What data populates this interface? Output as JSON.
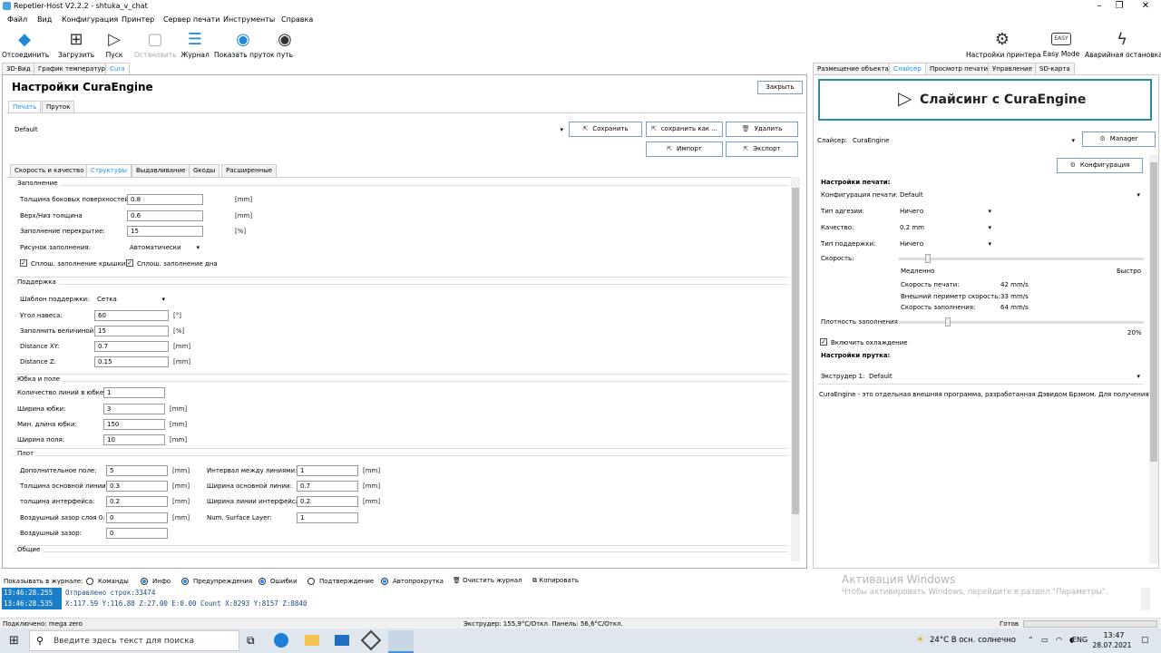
{
  "window": {
    "title": "Repetier-Host V2.2.2 - shtuka_v_chat"
  },
  "menu": [
    "Файл",
    "Вид",
    "Конфигурация",
    "Принтер",
    "Сервер печати",
    "Инструменты",
    "Справка"
  ],
  "toolbar": {
    "disconnect": "Отсоединить",
    "load": "Загрузить",
    "run": "Пуск",
    "stop": "Остановить",
    "journal": "Журнал",
    "show_filament": "Показать пруток",
    "path": "путь",
    "printer_settings": "Настройки принтера",
    "easy_mode": "Easy Mode",
    "easy_badge": "EASY",
    "emergency": "Аварийная остановка"
  },
  "left_tabs": [
    "3D-Вид",
    "График температур",
    "Cura"
  ],
  "right_tabs": [
    "Размещение объекта",
    "Слайсер",
    "Просмотр печати",
    "Управление",
    "SD-карта"
  ],
  "cura": {
    "title": "Настройки CuraEngine",
    "close": "Закрыть",
    "subtabs": [
      "Печать",
      "Пруток"
    ],
    "profile": "Default",
    "buttons": {
      "save": "Сохранить",
      "save_as": "сохранить как ...",
      "delete": "Удалить",
      "import": "Импорт",
      "export": "Экспорт"
    },
    "section_tabs": [
      "Скорость и качество",
      "Структуры",
      "Выдавливание",
      "Gкоды",
      "Расширенные"
    ],
    "infill": {
      "title": "Заполнение",
      "shell": {
        "label": "Толщина боковых поверхностей:",
        "value": "0.8",
        "unit": "[mm]"
      },
      "topbottom": {
        "label": "Верх/Низ толщина",
        "value": "0.6",
        "unit": "[mm]"
      },
      "overlap": {
        "label": "Заполнение перекрытие:",
        "value": "15",
        "unit": "[%]"
      },
      "pattern": {
        "label": "Рисунок заполнения:",
        "value": "Автоматически"
      },
      "solid_top": "Сплош. заполнение крышки",
      "solid_bottom": "Сплош. заполнение дна"
    },
    "support": {
      "title": "Поддержка",
      "template": {
        "label": "Шаблон поддержки:",
        "value": "Сетка"
      },
      "angle": {
        "label": "Угол навеса:",
        "value": "60",
        "unit": "[°]"
      },
      "fill": {
        "label": "Заполнить величиной:",
        "value": "15",
        "unit": "[%]"
      },
      "dxy": {
        "label": "Distance XY:",
        "value": "0.7",
        "unit": "[mm]"
      },
      "dz": {
        "label": "Distance Z:",
        "value": "0.15",
        "unit": "[mm]"
      }
    },
    "skirt": {
      "title": "Юбка и поле",
      "lines": {
        "label": "Количество линий в юбке:",
        "value": "1"
      },
      "width": {
        "label": "Ширина юбки:",
        "value": "3",
        "unit": "[mm]"
      },
      "minlen": {
        "label": "Мин. длина юбки:",
        "value": "150",
        "unit": "[mm]"
      },
      "brim": {
        "label": "Ширина поля:",
        "value": "10",
        "unit": "[mm]"
      }
    },
    "raft": {
      "title": "Плот",
      "extra": {
        "label": "Дополнительное поле:",
        "value": "5",
        "unit": "[mm]"
      },
      "base": {
        "label": "Толщина основной линии:",
        "value": "0.3",
        "unit": "[mm]"
      },
      "iface": {
        "label": "толщина интерфейса:",
        "value": "0.2",
        "unit": "[mm]"
      },
      "gap0": {
        "label": "Воздушный зазор слоя 0:",
        "value": "0",
        "unit": "[mm]"
      },
      "gap": {
        "label": "Воздушный зазор:",
        "value": "0"
      },
      "interval": {
        "label": "Интервал между линиями:",
        "value": "1",
        "unit": "[mm]"
      },
      "basew": {
        "label": "Ширина основной линии:",
        "value": "0.7",
        "unit": "[mm]"
      },
      "ifacew": {
        "label": "Ширина линии интерфейса:",
        "value": "0.2",
        "unit": "[mm]"
      },
      "surface": {
        "label": "Num. Surface Layer:",
        "value": "1"
      }
    },
    "general_title": "Общие"
  },
  "slicer": {
    "big_button": "Слайсинг с CuraEngine",
    "slicer_label": "Слайсер:",
    "slicer_value": "CuraEngine",
    "manager": "Manager",
    "config": "Конфигурация",
    "print_settings": "Настройки печати:",
    "print_config": {
      "label": "Конфигурация печати:",
      "value": "Default"
    },
    "adhesion": {
      "label": "Тип адгезии:",
      "value": "Ничего"
    },
    "quality": {
      "label": "Качество:",
      "value": "0.2 mm"
    },
    "support": {
      "label": "Тип поддержки:",
      "value": "Ничего"
    },
    "speed_label": "Скорость:",
    "slow": "Медленно",
    "fast": "Быстро",
    "speed": 0.12,
    "print_speed": {
      "label": "Скорость печати:",
      "value": "42 mm/s"
    },
    "perimeter_speed": {
      "label": "Внешний периметр скорость:",
      "value": "33 mm/s"
    },
    "infill_speed": {
      "label": "Скорость заполнения:",
      "value": "64 mm/s"
    },
    "density_label": "Плотность заполнения",
    "density_value": "20%",
    "density": 0.2,
    "cooling": "Включить охлаждение",
    "filament_settings": "Настройки прутка:",
    "extruder": {
      "label": "Экструдер 1:",
      "value": "Default"
    },
    "info": "CuraEngine - это отдельная внешняя программа, разработанная Дэвидом Брэмом. Для получения дополните"
  },
  "log": {
    "show": "Показывать в журнале:",
    "filters": [
      "Команды",
      "Инфо",
      "Предупреждения",
      "Ошибки",
      "Подтверждение",
      "Автопрокрутка"
    ],
    "clear": "Очистить журнал",
    "copy": "Копировать",
    "lines": [
      {
        "ts": "13:46:28.255",
        "msg": "Отправлено строк:33474"
      },
      {
        "ts": "13:46:28.535",
        "msg": "X:117.59 Y:116.88 Z:27.00 E:0.00 Count X:8293 Y:8157 Z:8840"
      }
    ],
    "watermark1": "Активация Windows",
    "watermark2": "Чтобы активировать Windows, перейдите в раздел \"Параметры\"."
  },
  "status": {
    "connected": "Подключено: mega zero",
    "temps": "Экструдер: 155,9°C/Откл. Панель: 56,6°C/Откл.",
    "ready": "Готов"
  },
  "taskbar": {
    "search": "Введите здесь текст для поиска",
    "weather": "24°C  В осн. солнечно",
    "lang": "ENG",
    "time": "13:47",
    "date": "28.07.2021"
  }
}
